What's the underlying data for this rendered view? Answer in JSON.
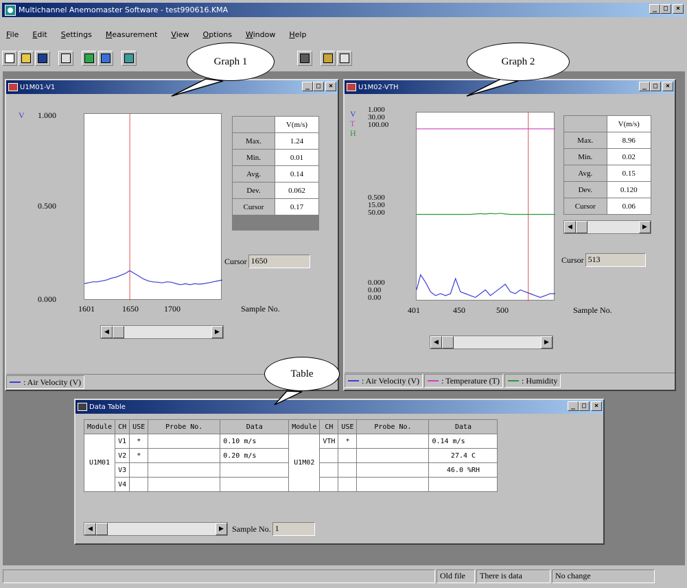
{
  "app": {
    "title": "Multichannel Anemomaster Software - test990616.KMA",
    "window_buttons": [
      "_",
      "□",
      "×"
    ],
    "menu": [
      "File",
      "Edit",
      "Settings",
      "Measurement",
      "View",
      "Options",
      "Window",
      "Help"
    ],
    "toolbar_icons": [
      "new-icon",
      "open-icon",
      "save-icon",
      "print-icon",
      "green-icon",
      "chart-icon",
      "grid-icon",
      "meter-icon",
      "export1-icon",
      "export2-icon"
    ]
  },
  "callouts": {
    "graph1": "Graph 1",
    "graph2": "Graph 2",
    "table": "Table"
  },
  "graph1": {
    "title": "U1M01-V1",
    "series_letters": [
      "V"
    ],
    "y_ticks": [
      "1.000",
      "0.500",
      "0.000"
    ],
    "x_ticks": [
      "1601",
      "1650",
      "1700"
    ],
    "xlabel": "Sample No.",
    "stats_header": "V(m/s)",
    "stats": [
      {
        "label": "Max.",
        "value": "1.24"
      },
      {
        "label": "Min.",
        "value": "0.01"
      },
      {
        "label": "Avg.",
        "value": "0.14"
      },
      {
        "label": "Dev.",
        "value": "0.062"
      },
      {
        "label": "Cursor",
        "value": "0.17"
      }
    ],
    "cursor_label": "Cursor",
    "cursor_value": "1650",
    "legend": [
      {
        "text": ": Air Velocity (V)",
        "color": "#3d3dd6"
      }
    ]
  },
  "graph2": {
    "title": "U1M02-VTH",
    "series_letters": [
      "V",
      "T",
      "H"
    ],
    "y_ticks_top": [
      "1.000",
      "30.00",
      "100.00"
    ],
    "y_ticks_mid": [
      "0.500",
      "15.00",
      "50.00"
    ],
    "y_ticks_bot": [
      "0.000",
      "0.00",
      "0.00"
    ],
    "x_ticks": [
      "401",
      "450",
      "500"
    ],
    "xlabel": "Sample No.",
    "stats_header": "V(m/s)",
    "stats": [
      {
        "label": "Max.",
        "value": "8.96"
      },
      {
        "label": "Min.",
        "value": "0.02"
      },
      {
        "label": "Avg.",
        "value": "0.15"
      },
      {
        "label": "Dev.",
        "value": "0.120"
      },
      {
        "label": "Cursor",
        "value": "0.06"
      }
    ],
    "cursor_label": "Cursor",
    "cursor_value": "513",
    "legend": [
      {
        "text": ": Air Velocity (V)",
        "color": "#3d3dd6"
      },
      {
        "text": ": Temperature (T)",
        "color": "#d040c0"
      },
      {
        "text": ": Humidity",
        "color": "#2a9a3a"
      }
    ]
  },
  "datatable": {
    "title": "Data Table",
    "headers": [
      "Module",
      "CH",
      "USE",
      "Probe No.",
      "Data",
      "Module",
      "CH",
      "USE",
      "Probe No.",
      "Data"
    ],
    "left_module": "U1M01",
    "right_module": "U1M02",
    "rows": [
      {
        "ch1": "V1",
        "use1": "*",
        "probe1": "",
        "data1": "0.10 m/s",
        "ch2": "VTH",
        "use2": "*",
        "probe2": "",
        "data2": "0.14 m/s"
      },
      {
        "ch1": "V2",
        "use1": "*",
        "probe1": "",
        "data1": "0.20 m/s",
        "ch2": "",
        "use2": "",
        "probe2": "",
        "data2": "27.4 C"
      },
      {
        "ch1": "V3",
        "use1": "",
        "probe1": "",
        "data1": "",
        "ch2": "",
        "use2": "",
        "probe2": "",
        "data2": "46.0 %RH"
      },
      {
        "ch1": "V4",
        "use1": "",
        "probe1": "",
        "data1": "",
        "ch2": "",
        "use2": "",
        "probe2": "",
        "data2": ""
      }
    ],
    "sample_label": "Sample No.",
    "sample_value": "1"
  },
  "status": [
    "",
    "Old file",
    "There is data",
    "No change"
  ],
  "colors": {
    "velocity": "#3d3dd6",
    "temperature": "#d040c0",
    "humidity": "#2a9a3a",
    "cursor": "#e05050"
  },
  "chart_data": [
    {
      "type": "line",
      "name": "Graph 1",
      "x": [
        1601,
        1605,
        1610,
        1615,
        1620,
        1625,
        1630,
        1635,
        1640,
        1645,
        1650,
        1655,
        1660,
        1665,
        1670,
        1675,
        1680,
        1685,
        1690,
        1695,
        1700,
        1705,
        1710,
        1715,
        1720,
        1725,
        1730,
        1735,
        1740,
        1745,
        1750
      ],
      "series": [
        {
          "name": "Air Velocity (V)",
          "values": [
            0.09,
            0.095,
            0.1,
            0.1,
            0.105,
            0.11,
            0.12,
            0.125,
            0.135,
            0.145,
            0.16,
            0.145,
            0.13,
            0.115,
            0.105,
            0.1,
            0.098,
            0.095,
            0.1,
            0.098,
            0.09,
            0.085,
            0.09,
            0.085,
            0.09,
            0.088,
            0.09,
            0.095,
            0.1,
            0.105,
            0.11
          ]
        }
      ],
      "cursor_x": 1650,
      "ylim": [
        0,
        1.0
      ],
      "xlim": [
        1601,
        1750
      ],
      "xlabel": "Sample No."
    },
    {
      "type": "line",
      "name": "Graph 2",
      "x": [
        401,
        405,
        410,
        415,
        420,
        425,
        430,
        435,
        440,
        445,
        450,
        455,
        460,
        465,
        470,
        475,
        480,
        485,
        490,
        495,
        500,
        505,
        510,
        515,
        520,
        525,
        530,
        535,
        540
      ],
      "series": [
        {
          "name": "Air Velocity (V)",
          "axis": "V",
          "values": [
            0.06,
            0.14,
            0.1,
            0.05,
            0.03,
            0.04,
            0.03,
            0.04,
            0.12,
            0.05,
            0.04,
            0.03,
            0.02,
            0.04,
            0.06,
            0.03,
            0.05,
            0.07,
            0.09,
            0.05,
            0.04,
            0.06,
            0.05,
            0.04,
            0.03,
            0.02,
            0.03,
            0.04,
            0.04
          ]
        },
        {
          "name": "Temperature (T)",
          "axis": "T",
          "values": [
            27.4,
            27.4,
            27.4,
            27.4,
            27.4,
            27.4,
            27.4,
            27.4,
            27.4,
            27.4,
            27.4,
            27.4,
            27.4,
            27.4,
            27.4,
            27.4,
            27.4,
            27.4,
            27.4,
            27.4,
            27.4,
            27.4,
            27.4,
            27.4,
            27.4,
            27.4,
            27.4,
            27.4,
            27.4
          ]
        },
        {
          "name": "Humidity",
          "axis": "H",
          "values": [
            46.0,
            46.0,
            46.0,
            46.0,
            46.0,
            46.0,
            46.0,
            46.0,
            46.0,
            46.0,
            46.0,
            46.0,
            46.2,
            46.4,
            46.2,
            46.5,
            46.3,
            46.6,
            46.2,
            46.0,
            46.0,
            46.0,
            46.0,
            46.0,
            46.0,
            46.0,
            46.0,
            46.0,
            46.0
          ]
        }
      ],
      "cursor_x": 513,
      "ylim_V": [
        0,
        1.0
      ],
      "ylim_T": [
        0,
        30
      ],
      "ylim_H": [
        0,
        100
      ],
      "xlim": [
        401,
        540
      ],
      "xlabel": "Sample No."
    }
  ]
}
